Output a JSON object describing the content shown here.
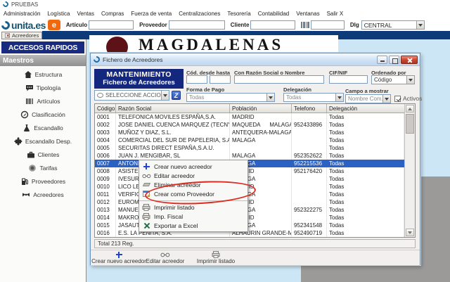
{
  "app": {
    "window_title": "PRUEBAS"
  },
  "menubar": {
    "items": [
      "Administración",
      "Logística",
      "Ventas",
      "Compras",
      "Fuerza de venta",
      "Centralizaciones",
      "Tesorería",
      "Contabilidad",
      "Ventanas",
      "Salir X"
    ]
  },
  "toolbar": {
    "logo_text": "unita.es",
    "logo_badge": "e",
    "articulo_label": "Artículo",
    "proveedor_label": "Proveedor",
    "cliente_label": "Cliente",
    "dlg_label": "Dlg",
    "dlg_value": "CENTRAL"
  },
  "tabbar": {
    "tab": "Acreedores"
  },
  "sidebar": {
    "title": "ACCESOS RAPIDOS",
    "section": "Maestros",
    "items": [
      {
        "label": "Estructura",
        "icon": "house-icon"
      },
      {
        "label": "Tipología",
        "icon": "speech-bubble-icon"
      },
      {
        "label": "Artículos",
        "icon": "barcode-icon"
      },
      {
        "label": "Clasificación",
        "icon": "compass-icon"
      },
      {
        "label": "Escandallo",
        "icon": "flask-icon"
      },
      {
        "label": "Escandallo Desp.",
        "icon": "puzzle-icon"
      },
      {
        "label": "Clientes",
        "icon": "briefcase-icon"
      },
      {
        "label": "Tarifas",
        "icon": "coin-icon"
      },
      {
        "label": "Proveedores",
        "icon": "fuel-pump-icon"
      },
      {
        "label": "Acreedores",
        "icon": "handshake-icon"
      }
    ]
  },
  "background": {
    "brand": "MAGDALENAS"
  },
  "dialog": {
    "title": "Fichero de Acreedores",
    "header_line1": "MANTENIMIENTO",
    "header_line2": "Fichero de Acreedores",
    "filters": {
      "cod_label": "Cód. desde hasta",
      "razon_label": "Con Razón Social o Nombre",
      "cif_label": "CIF/NIF",
      "ordenado_label": "Ordenado por",
      "ordenado_value": "Código",
      "accion_value": "SELECCIONE ACCION",
      "forma_label": "Forma de Pago",
      "forma_value": "Todas",
      "delegacion_label": "Delegación",
      "delegacion_value": "Todas",
      "campo_label": "Campo a mostrar",
      "campo_value": "Nombre Com.",
      "activos_label": "Activos"
    },
    "table": {
      "columns": [
        "Código",
        "Razón Social",
        "Población",
        "Telefono",
        "Delegación"
      ],
      "rows": [
        {
          "code": "0001",
          "name": "TELEFONICA MOVILES ESPAÑA,S.A.",
          "city": "MADRID",
          "phone": "",
          "deleg": "Todas"
        },
        {
          "code": "0002",
          "name": "JOSE DANIEL CUENCA MARQUEZ (TECNYSERVI)",
          "city": "MAQUEDA      MALAGA",
          "phone": "952433896",
          "deleg": "Todas"
        },
        {
          "code": "0003",
          "name": "MUÑOZ Y DIAZ, S.L.",
          "city": "ANTEQUERA-MALAGA",
          "phone": "",
          "deleg": "Todas"
        },
        {
          "code": "0004",
          "name": "COMERCIAL DEL SUR DE PAPELERIA, S.A",
          "city": "MALAGA",
          "phone": "",
          "deleg": "Todas"
        },
        {
          "code": "0005",
          "name": "SECURITAS DIRECT ESPAÑA,S.A.U.",
          "city": "",
          "phone": "",
          "deleg": "Todas"
        },
        {
          "code": "0006",
          "name": "JUAN J. MENGIBAR, SL",
          "city": "MALAGA",
          "phone": "952352622",
          "deleg": "Todas"
        },
        {
          "code": "0007",
          "name": "ANTONIA ROSAS DIAZ",
          "city": "MALAGA",
          "phone": "952215536",
          "deleg": "Todas",
          "cls": "selected"
        },
        {
          "code": "0008",
          "name": "ASISTENC",
          "city": "MADRID",
          "phone": "952176420",
          "deleg": "Todas"
        },
        {
          "code": "0009",
          "name": "IVESUR, S",
          "city": "MALAGA",
          "phone": "",
          "deleg": "Todas"
        },
        {
          "code": "0010",
          "name": "LICO LEAS",
          "city": "MADRID",
          "phone": "",
          "deleg": "Todas"
        },
        {
          "code": "0011",
          "name": "VERIFICA",
          "city": "MALAGA",
          "phone": "",
          "deleg": "Todas"
        },
        {
          "code": "0012",
          "name": "EUROMUT",
          "city": "MADRID",
          "phone": "",
          "deleg": "Todas"
        },
        {
          "code": "0013",
          "name": "MANUEL J",
          "city": "MALAGA",
          "phone": "952322275",
          "deleg": "Todas"
        },
        {
          "code": "0014",
          "name": "MAKRO A",
          "city": "MADRID",
          "phone": "",
          "deleg": "Todas"
        },
        {
          "code": "0015",
          "name": "JASAUTO",
          "city": "MALAGA",
          "phone": "952341548",
          "deleg": "Todas"
        },
        {
          "code": "0016",
          "name": "E.S. LA PEÑITA, S.A.",
          "city": "ALHAURIN GRANDE-MALAG",
          "phone": "952490719",
          "deleg": "Todas"
        }
      ]
    },
    "total": "Total 213 Reg.",
    "footer_buttons": [
      {
        "label": "Crear nuevo acreedor",
        "icon": "plus-icon"
      },
      {
        "label": "Editar acreedor",
        "icon": "glasses-icon"
      },
      {
        "label": "Imprimir listado",
        "icon": "printer-icon"
      }
    ]
  },
  "context_menu": {
    "items": [
      {
        "label": "Crear nuevo acreedor",
        "icon": "plus-icon"
      },
      {
        "label": "Editar acreedor",
        "icon": "glasses-icon"
      },
      {
        "label": "Eliminar acreedor",
        "icon": "eraser-icon"
      },
      {
        "label": "Crear como Proveedor",
        "icon": "form-edit-icon",
        "annotated": true
      },
      {
        "label": "Imprimir listado",
        "icon": "printer-icon"
      },
      {
        "label": "Imp. Fiscal",
        "icon": "printer-icon"
      },
      {
        "label": "Exportar a Excel",
        "icon": "excel-icon"
      }
    ]
  },
  "colors": {
    "navy": "#14277e",
    "tab_strip_navy": "#0d3a78",
    "selection_blue": "#2a61c3",
    "content_bg": "#cde6f5",
    "annotation_red": "#dd2b20",
    "brand_orange": "#f2690d",
    "close_red": "#cf4a33"
  }
}
